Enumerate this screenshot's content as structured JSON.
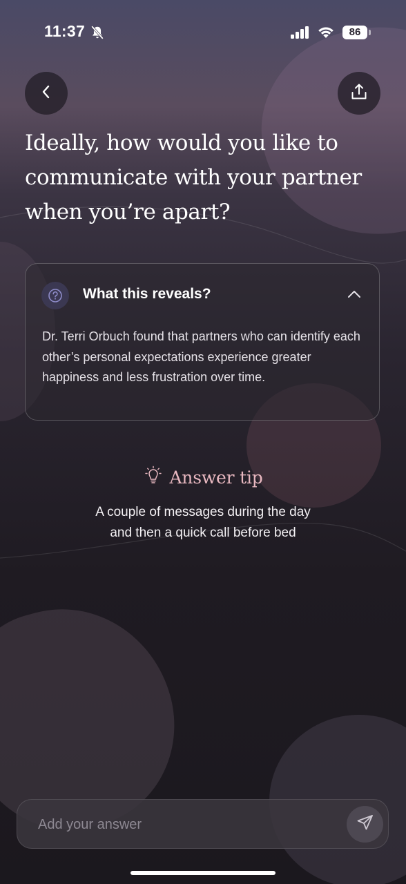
{
  "status_bar": {
    "time": "11:37",
    "battery": "86",
    "icons": [
      "bell-slash-icon",
      "signal-icon",
      "wifi-icon",
      "battery-icon"
    ]
  },
  "nav": {
    "back_icon": "chevron-left-icon",
    "share_icon": "share-icon"
  },
  "question": {
    "title": "Ideally, how would you like to communicate with your partner when you’re apart?"
  },
  "reveals": {
    "icon": "question-circle-icon",
    "title": "What this reveals?",
    "expanded": true,
    "chevron_icon": "chevron-up-icon",
    "body": "Dr. Terri Orbuch found that partners who can identify each other’s personal expectations experience greater happiness and less frustration over time."
  },
  "tip": {
    "icon": "lightbulb-icon",
    "title": "Answer tip",
    "text_line_1": "A couple of messages during the day",
    "text_line_2": "and then a quick call before bed"
  },
  "answer": {
    "placeholder": "Add your answer",
    "value": "",
    "send_icon": "send-icon"
  },
  "colors": {
    "accent_tip": "#e8b8c0",
    "question_icon_bg": "#3b3852",
    "question_icon_fg": "#8e8cc9",
    "card_border": "#5a5560",
    "input_bg": "#3a353e"
  }
}
